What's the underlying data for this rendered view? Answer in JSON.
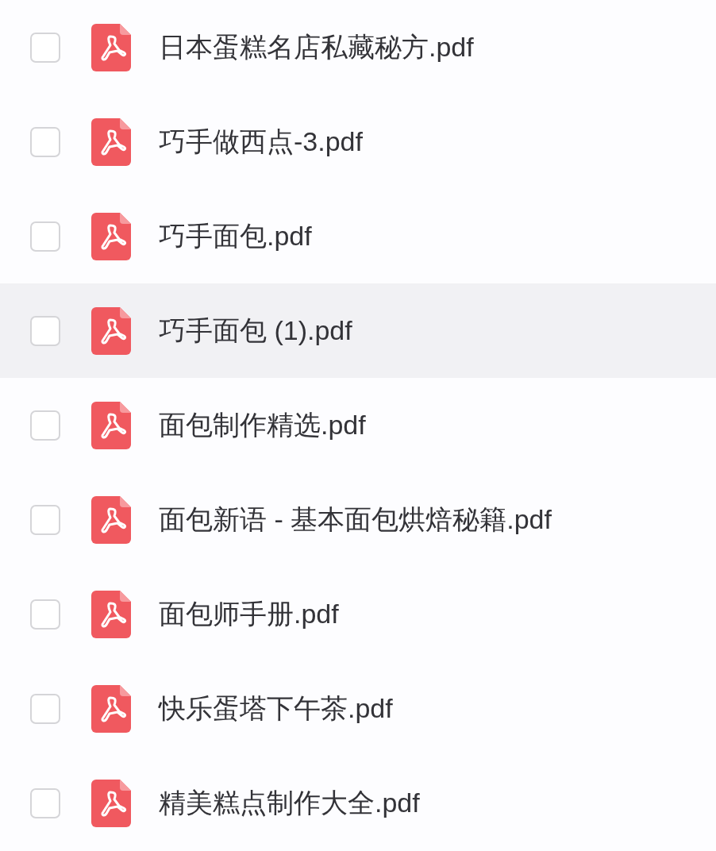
{
  "files": [
    {
      "name": "日本蛋糕名店私藏秘方.pdf",
      "checked": false,
      "highlighted": false
    },
    {
      "name": "巧手做西点-3.pdf",
      "checked": false,
      "highlighted": false
    },
    {
      "name": "巧手面包.pdf",
      "checked": false,
      "highlighted": false
    },
    {
      "name": "巧手面包 (1).pdf",
      "checked": false,
      "highlighted": true
    },
    {
      "name": "面包制作精选.pdf",
      "checked": false,
      "highlighted": false
    },
    {
      "name": "面包新语 - 基本面包烘焙秘籍.pdf",
      "checked": false,
      "highlighted": false
    },
    {
      "name": "面包师手册.pdf",
      "checked": false,
      "highlighted": false
    },
    {
      "name": "快乐蛋塔下午茶.pdf",
      "checked": false,
      "highlighted": false
    },
    {
      "name": "精美糕点制作大全.pdf",
      "checked": false,
      "highlighted": false
    }
  ]
}
